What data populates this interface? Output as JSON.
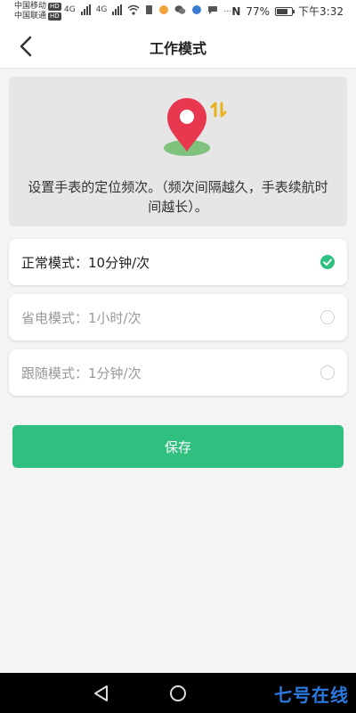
{
  "status_bar": {
    "carrier_1": "中国移动",
    "carrier_2": "中国联通",
    "hd_badge": "HD",
    "network_1": "4G",
    "network_2": "4G",
    "battery_text": "77%",
    "battery_level": 0.77,
    "time": "下午3:32"
  },
  "header": {
    "title": "工作模式",
    "back_icon": "chevron-left-icon"
  },
  "info": {
    "icon": "location-pin-icon",
    "text": "设置手表的定位频次。（频次间隔越久，手表续航时间越长）。"
  },
  "options": [
    {
      "label": "正常模式：10分钟/次",
      "selected": true
    },
    {
      "label": "省电模式：1小时/次",
      "selected": false
    },
    {
      "label": "跟随模式：1分钟/次",
      "selected": false
    }
  ],
  "save_button": {
    "label": "保存"
  },
  "nav_bar": {
    "back_icon": "triangle-back-icon",
    "home_icon": "circle-home-icon",
    "watermark": "七号在线"
  },
  "colors": {
    "accent": "#2fbf7f",
    "pin": "#e8384f",
    "info_bg": "#e6e6e6"
  }
}
